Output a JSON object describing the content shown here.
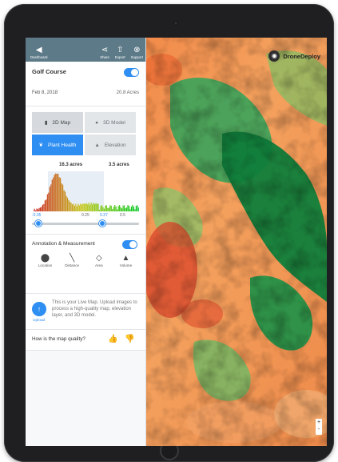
{
  "topbar": {
    "dashboard_label": "Dashboard",
    "share_label": "Share",
    "export_label": "Export",
    "support_label": "Support"
  },
  "project": {
    "name": "Golf Course",
    "date": "Feb 8, 2018",
    "area": "20.8 Acres",
    "toggle_on": true
  },
  "layers": {
    "items": [
      {
        "label": "2D Map",
        "icon": "map-icon",
        "state": "selected"
      },
      {
        "label": "3D Model",
        "icon": "globe-icon",
        "state": "default"
      },
      {
        "label": "Plant Health",
        "icon": "leaf-icon",
        "state": "active"
      },
      {
        "label": "Elevation",
        "icon": "mountain-icon",
        "state": "default"
      }
    ]
  },
  "histogram": {
    "left_acres": "16.3 acres",
    "right_acres": "3.5 acres",
    "ticks": [
      "-0.05",
      "0.25",
      "0.37",
      "0.5"
    ],
    "slider_low": "-0.05",
    "slider_high": "0.37"
  },
  "annotation": {
    "title": "Annotation & Measurement",
    "toggle_on": true,
    "tools": [
      {
        "label": "Location",
        "icon": "location-pin-icon"
      },
      {
        "label": "Distance",
        "icon": "ruler-icon"
      },
      {
        "label": "Area",
        "icon": "area-icon"
      },
      {
        "label": "Volume",
        "icon": "volume-icon"
      }
    ]
  },
  "upload": {
    "label": "Upload",
    "message": "This is your Live Map. Upload images to process a high-quality map, elevation layer, and 3D model."
  },
  "quality": {
    "question": "How is the map quality?"
  },
  "brand": {
    "name": "DroneDeploy"
  },
  "map_controls": {
    "zoom_in": "+",
    "zoom_out": "-"
  },
  "colors": {
    "accent": "#2e8ef2",
    "topbar": "#5d7a88"
  }
}
